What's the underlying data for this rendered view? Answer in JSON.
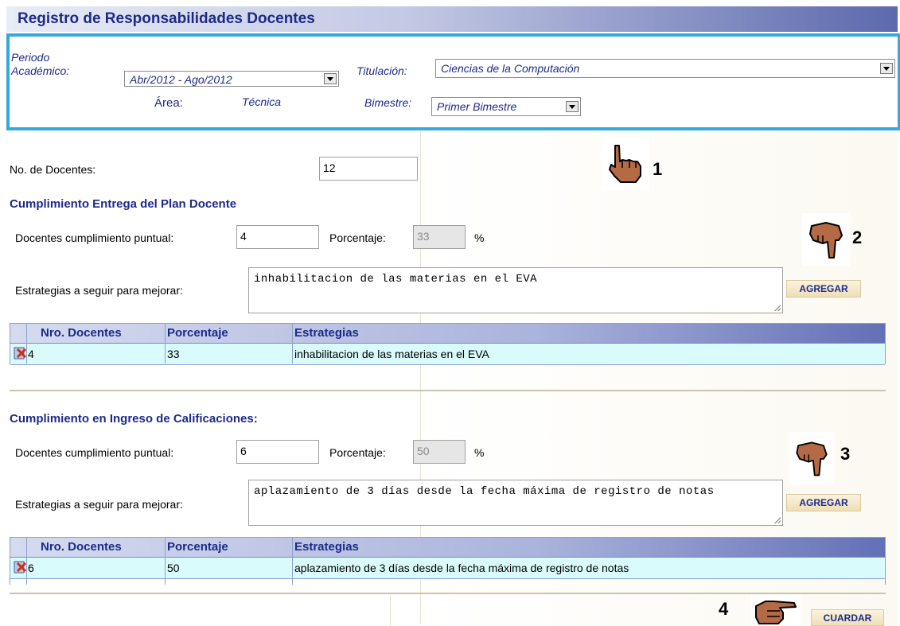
{
  "title": "Registro de Responsabilidades Docentes",
  "filters": {
    "periodo_label": "Periodo\nAcadémico:",
    "periodo_value": "Abr/2012 - Ago/2012",
    "area_label": "Área:",
    "area_value": "Técnica",
    "titulacion_label": "Titulación:",
    "titulacion_value": "Ciencias de la Computación",
    "bimestre_label": "Bimestre:",
    "bimestre_value": "Primer Bimestre"
  },
  "docentes": {
    "label": "No. de Docentes:",
    "value": "12"
  },
  "plan": {
    "title": "Cumplimiento Entrega del Plan Docente",
    "cumplimiento_label": "Docentes cumplimiento puntual:",
    "cumplimiento_value": "4",
    "porcentaje_label": "Porcentaje:",
    "porcentaje_value": "33",
    "percent_sign": "%",
    "estrategias_label": "Estrategias a seguir para mejorar:",
    "estrategias_value": "inhabilitacion de las materias en el EVA",
    "add_label": "AGREGAR",
    "table": {
      "headers": [
        "Nro. Docentes",
        "Porcentaje",
        "Estrategias"
      ],
      "rows": [
        {
          "docentes": "4",
          "porcentaje": "33",
          "estrategia": "inhabilitacion de las materias en el EVA"
        }
      ]
    }
  },
  "calificaciones": {
    "title": "Cumplimiento en Ingreso de Calificaciones:",
    "cumplimiento_label": "Docentes cumplimiento puntual:",
    "cumplimiento_value": "6",
    "porcentaje_label": "Porcentaje:",
    "porcentaje_value": "50",
    "percent_sign": "%",
    "estrategias_label": "Estrategias a seguir para mejorar:",
    "estrategias_value": "aplazamiento de 3 días desde la fecha máxima de registro de notas",
    "add_label": "AGREGAR",
    "table": {
      "headers": [
        "Nro. Docentes",
        "Porcentaje",
        "Estrategias"
      ],
      "rows": [
        {
          "docentes": "6",
          "porcentaje": "50",
          "estrategia": "aplazamiento de 3 días desde la fecha máxima de registro de notas"
        }
      ]
    }
  },
  "save_label": "CUARDAR",
  "annotations": {
    "n1": "1",
    "n2": "2",
    "n3": "3",
    "n4": "4"
  },
  "icons": {
    "delete": "delete-icon",
    "hand": "pointing-hand-icon",
    "dropdown": "chevron-down-icon"
  },
  "colors": {
    "accent": "#1e2a8a",
    "frame": "#35a8de",
    "row": "#d9fbfb"
  }
}
